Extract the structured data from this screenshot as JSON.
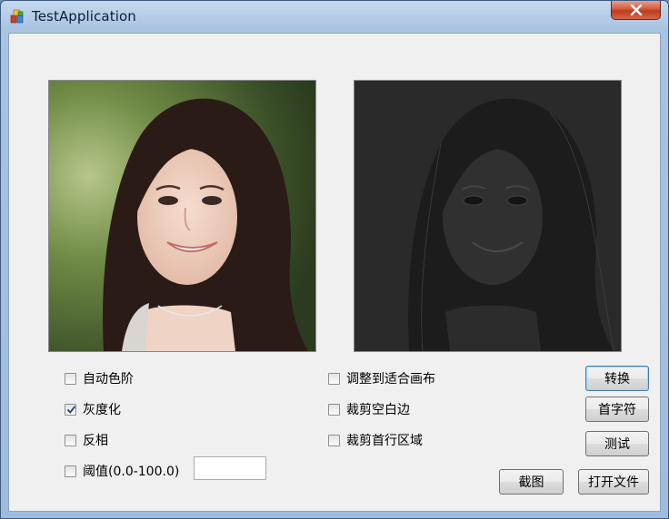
{
  "window": {
    "title": "TestApplication"
  },
  "options_left": [
    {
      "label": "自动色阶",
      "checked": false
    },
    {
      "label": "灰度化",
      "checked": true
    },
    {
      "label": "反相",
      "checked": false
    },
    {
      "label": "阈值(0.0-100.0)",
      "checked": false
    }
  ],
  "options_right": [
    {
      "label": "调整到适合画布",
      "checked": false
    },
    {
      "label": "裁剪空白边",
      "checked": false
    },
    {
      "label": "裁剪首行区域",
      "checked": false
    }
  ],
  "threshold": {
    "value": ""
  },
  "buttons": {
    "convert": "转换",
    "first_char": "首字符",
    "test": "测试",
    "screenshot": "截图",
    "open_file": "打开文件"
  },
  "icons": {
    "app": "app-icon",
    "close": "close-icon",
    "check": "checkmark-icon"
  },
  "colors": {
    "close_button": "#c1381a",
    "client_bg": "#f0f0f0",
    "titlebar": "#a9c3e2"
  }
}
